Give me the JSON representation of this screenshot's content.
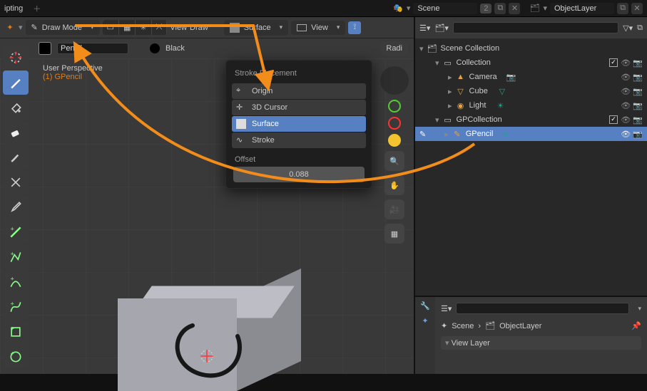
{
  "top": {
    "workspace_tab": "ipting",
    "scene_label": "Scene",
    "scene_users": "2",
    "layer_label": "ObjectLayer"
  },
  "viewport_header": {
    "mode": "Draw Mode",
    "menu_view": "View",
    "menu_draw": "Draw",
    "placement_value": "Surface",
    "guide_value": "View"
  },
  "tool_header": {
    "pencil_field": "Pencil",
    "material_name": "Black",
    "radius_label": "Radi"
  },
  "overlay": {
    "line1": "User Perspective",
    "line2": "(1) GPencil"
  },
  "popover": {
    "title": "Stroke Placement",
    "options": [
      {
        "label": "Origin"
      },
      {
        "label": "3D Cursor"
      },
      {
        "label": "Surface"
      },
      {
        "label": "Stroke"
      }
    ],
    "selected_index": 2,
    "offset_label": "Offset",
    "offset_value": "0.088"
  },
  "outliner": {
    "root": "Scene Collection",
    "items": [
      {
        "name": "Collection",
        "type": "collection",
        "depth": 1
      },
      {
        "name": "Camera",
        "type": "camera",
        "depth": 2
      },
      {
        "name": "Cube",
        "type": "mesh",
        "depth": 2
      },
      {
        "name": "Light",
        "type": "light",
        "depth": 2
      },
      {
        "name": "GPCollection",
        "type": "collection",
        "depth": 1
      },
      {
        "name": "GPencil",
        "type": "gp",
        "depth": 2,
        "selected": true
      }
    ],
    "search_placeholder": ""
  },
  "props": {
    "scene_crumb": "Scene",
    "layer_crumb": "ObjectLayer",
    "panel": "View Layer",
    "search_placeholder": ""
  }
}
